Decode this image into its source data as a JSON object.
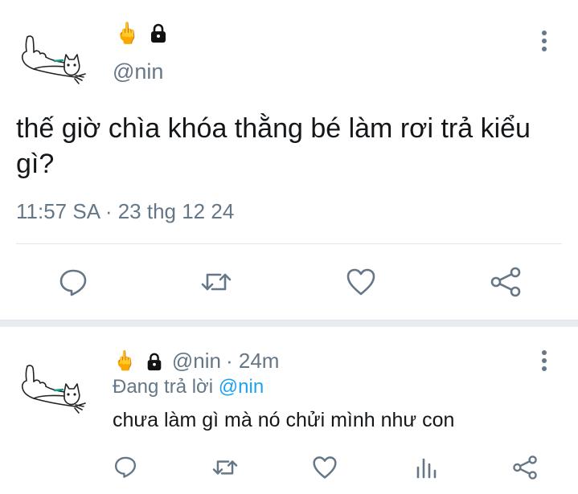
{
  "main_tweet": {
    "handle": "@nin",
    "emoji_finger": "🖕",
    "lock_icon": "lock-icon",
    "text": "thế giờ chìa khóa thằng bé làm rơi trả kiểu gì?",
    "timestamp": "11:57 SA · 23 thg 12 24",
    "actions": [
      "reply-icon",
      "retweet-icon",
      "like-icon",
      "share-icon"
    ]
  },
  "reply_tweet": {
    "emoji_finger": "🖕",
    "handle": "@nin",
    "time": "· 24m",
    "replying_prefix": "Đang trả lời",
    "replying_mention": "@nin",
    "text": "chưa làm gì mà nó chửi mình như con",
    "actions": [
      "reply-icon",
      "retweet-icon",
      "like-icon",
      "analytics-icon",
      "share-icon"
    ]
  },
  "colors": {
    "text": "#14171a",
    "secondary": "#657786",
    "accent": "#1da1f2",
    "divider": "#e1e8ed"
  }
}
